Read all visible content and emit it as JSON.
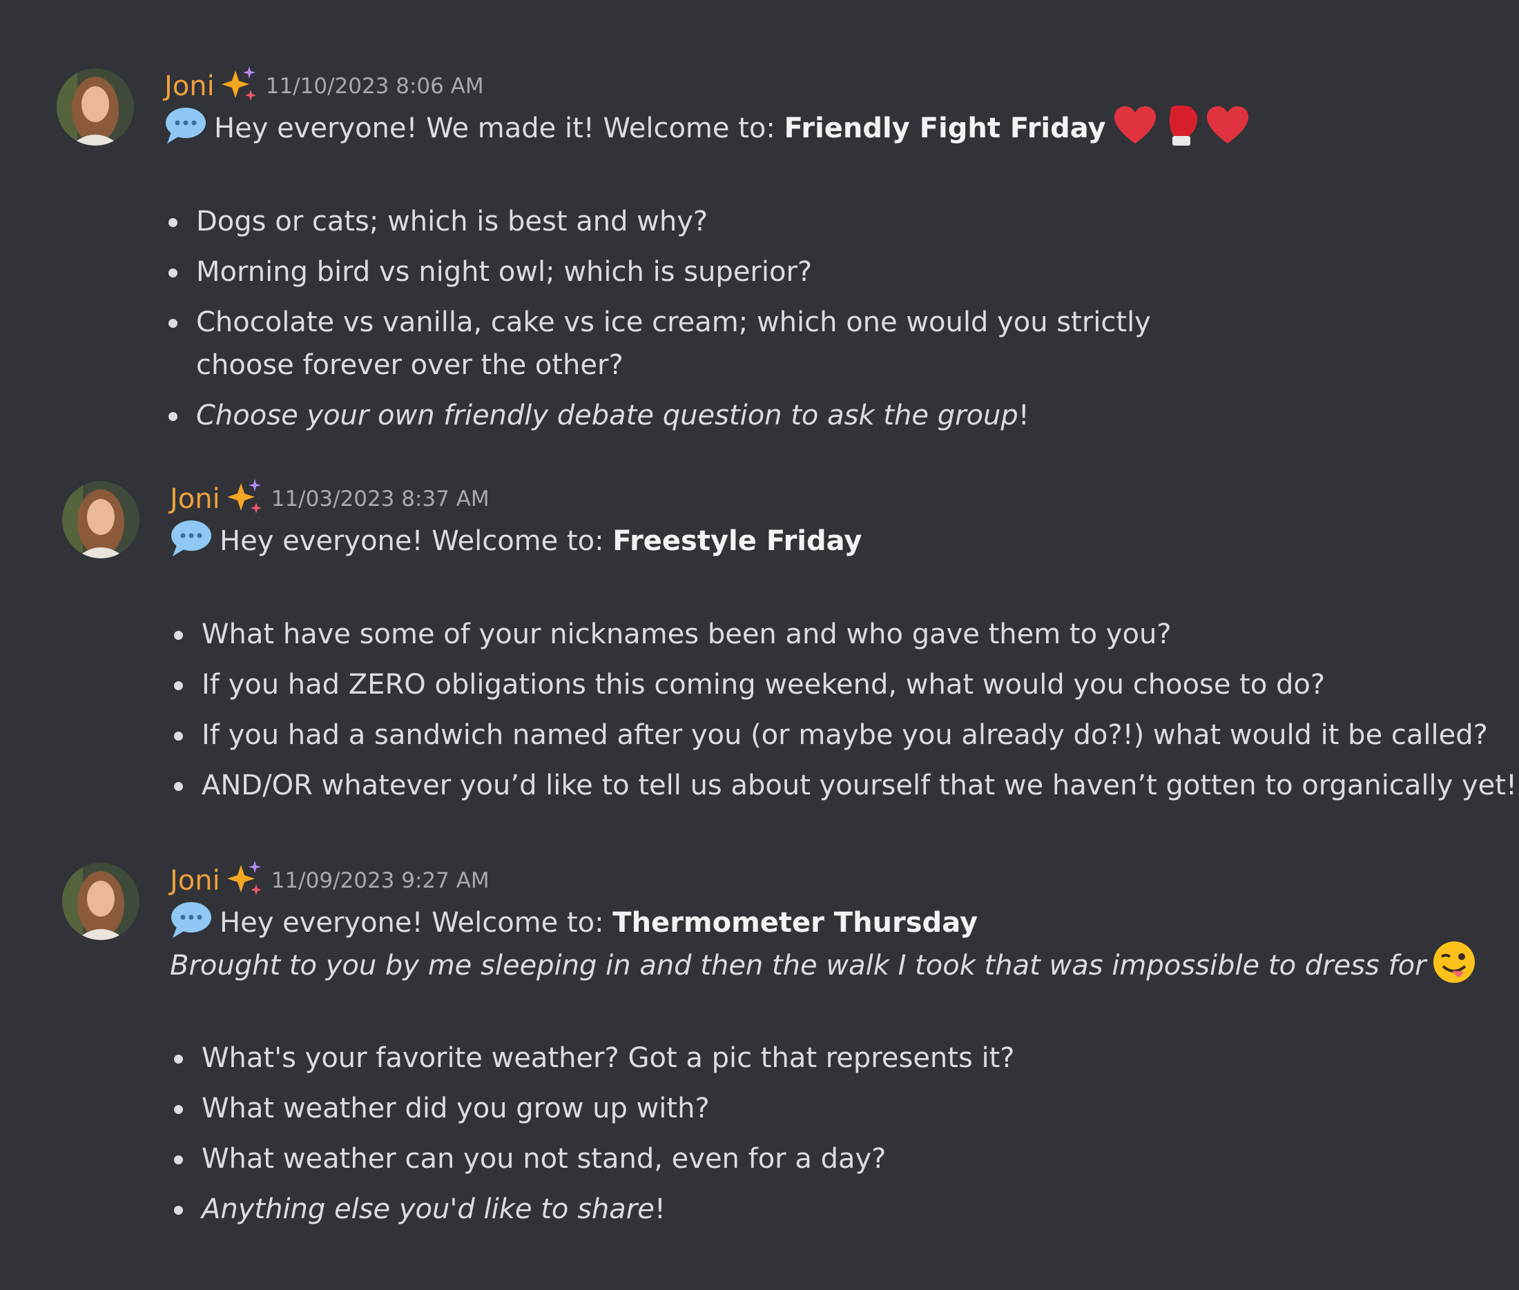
{
  "messages": [
    {
      "username": "Joni",
      "timestamp": "11/10/2023 8:06 AM",
      "intro": "Hey everyone! We made it! Welcome to: ",
      "title": "Friendly Fight Friday",
      "title_emojis": [
        "heart-icon",
        "boxing-glove-icon",
        "heart-icon"
      ],
      "bullets": [
        {
          "text": "Dogs or cats; which is best and why?"
        },
        {
          "text": "Morning bird vs night owl; which is superior?"
        },
        {
          "text": "Chocolate vs vanilla, cake vs ice cream; which one would you strictly choose forever over the other?"
        },
        {
          "italic": "Choose your own friendly debate question to ask the group",
          "tail": "!"
        }
      ]
    },
    {
      "username": "Joni",
      "timestamp": "11/03/2023 8:37 AM",
      "intro": "Hey everyone! Welcome to: ",
      "title": "Freestyle Friday",
      "bullets": [
        {
          "text": "What have some of your nicknames been and who gave them to you?"
        },
        {
          "text": "If you had ZERO obligations this coming weekend, what would you choose to do?"
        },
        {
          "text": "If you had a sandwich named after you (or maybe you already do?!) what would it be called?"
        },
        {
          "text": "AND/OR whatever you’d like to tell us about yourself that we haven’t gotten to organically yet!"
        }
      ]
    },
    {
      "username": "Joni",
      "timestamp": "11/09/2023 9:27 AM",
      "intro": "Hey everyone! Welcome to: ",
      "title": "Thermometer Thursday",
      "subtitle": "Brought to you by me sleeping in and then the walk I took that was impossible to dress for",
      "subtitle_emoji": "winking-tongue-face-icon",
      "bullets": [
        {
          "text": "What's your favorite weather? Got a pic that represents it?"
        },
        {
          "text": "What weather did you grow up with?"
        },
        {
          "text": "What weather can you not stand, even for a day?"
        },
        {
          "italic": "Anything else you'd like to share",
          "tail": "!"
        }
      ]
    }
  ],
  "colors": {
    "background": "#313338",
    "username": "#f0a03c",
    "timestamp": "#a7aab0",
    "text": "#dbdee1"
  }
}
